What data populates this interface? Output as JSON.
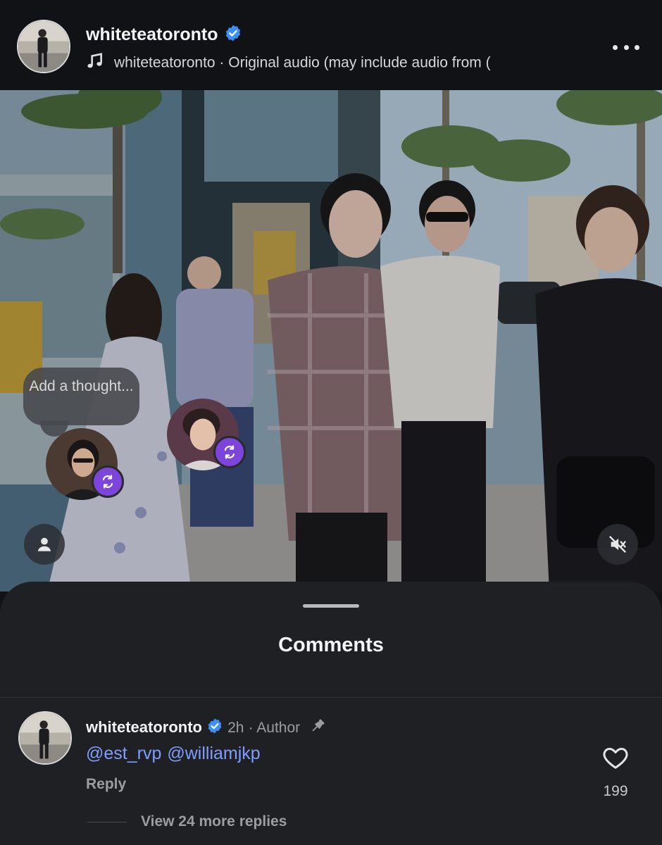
{
  "header": {
    "username": "whiteteatoronto",
    "audio_text": "whiteteatoronto · Original audio  (may include audio from (",
    "more_icon": "more-horizontal-icon"
  },
  "video": {
    "thought_placeholder": "Add a thought...",
    "user_icon": "person-icon",
    "mute_icon": "speaker-muted-icon",
    "repost_icon": "repost-icon"
  },
  "comments": {
    "title": "Comments",
    "items": [
      {
        "username": "whiteteatoronto",
        "time": "2h",
        "author_label": "Author",
        "mentions": [
          "@est_rvp",
          "@williamjkp"
        ],
        "reply_label": "Reply",
        "likes": "199",
        "view_replies": "View 24 more replies"
      }
    ]
  },
  "colors": {
    "background": "#121316",
    "sheet": "#1f2024",
    "mention": "#7f9dff",
    "verified": "#3d8ff5",
    "repost_badge": "#7d45d9"
  }
}
